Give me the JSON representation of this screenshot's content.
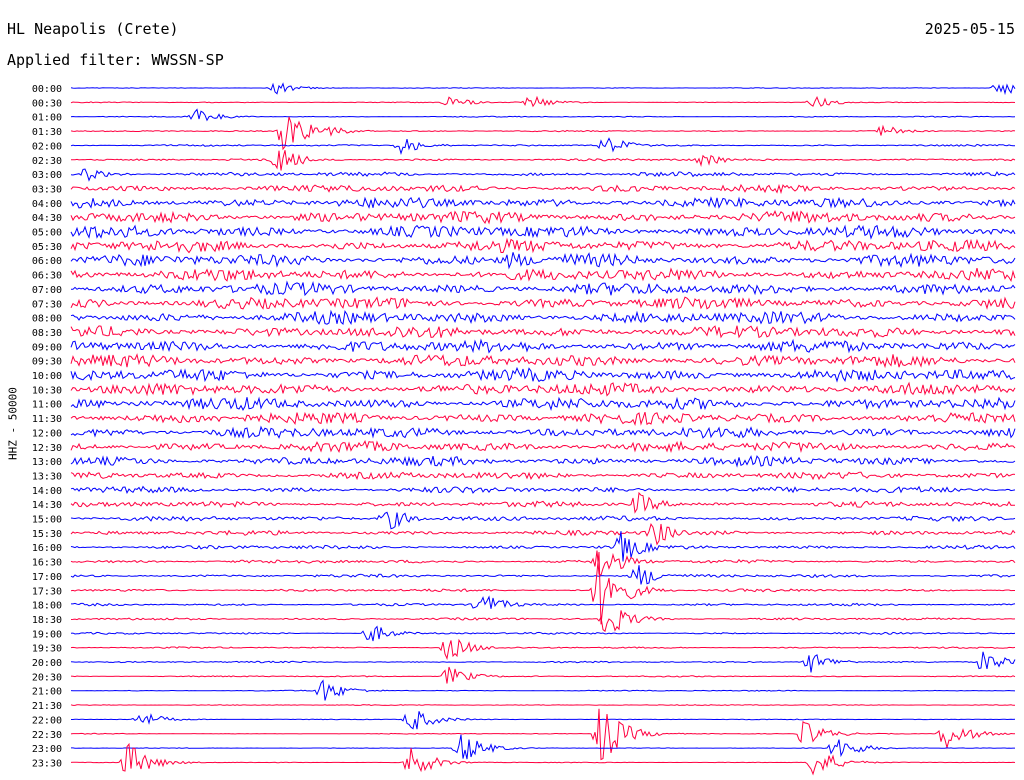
{
  "header": {
    "station": "HL Neapolis (Crete)",
    "date": "2025-05-15",
    "filter": "Applied filter: WWSSN-SP"
  },
  "chart_data": {
    "type": "line",
    "ylabel": "HHZ - 50000",
    "xlabel": "",
    "grid": false,
    "legend": "none",
    "row_labels": [
      "00:00",
      "00:30",
      "01:00",
      "01:30",
      "02:00",
      "02:30",
      "03:00",
      "03:30",
      "04:00",
      "04:30",
      "05:00",
      "05:30",
      "06:00",
      "06:30",
      "07:00",
      "07:30",
      "08:00",
      "08:30",
      "09:00",
      "09:30",
      "10:00",
      "10:30",
      "11:00",
      "11:30",
      "12:00",
      "12:30",
      "13:00",
      "13:30",
      "14:00",
      "14:30",
      "15:00",
      "15:30",
      "16:00",
      "16:30",
      "17:00",
      "17:30",
      "18:00",
      "18:30",
      "19:00",
      "19:30",
      "20:00",
      "20:30",
      "21:00",
      "21:30",
      "22:00",
      "22:30",
      "23:00",
      "23:30"
    ],
    "series_colors": [
      "#0000ff",
      "#ff0040"
    ],
    "noise_amplitude_by_row": [
      0.05,
      0.08,
      0.08,
      0.1,
      0.14,
      0.2,
      0.35,
      0.6,
      0.85,
      0.95,
      1.0,
      1.0,
      1.0,
      1.0,
      1.0,
      1.0,
      1.0,
      1.0,
      1.0,
      1.0,
      1.0,
      1.0,
      1.0,
      0.95,
      0.9,
      0.85,
      0.75,
      0.6,
      0.5,
      0.45,
      0.4,
      0.38,
      0.32,
      0.28,
      0.25,
      0.22,
      0.2,
      0.18,
      0.15,
      0.12,
      0.12,
      0.1,
      0.08,
      0.07,
      0.06,
      0.06,
      0.05,
      0.05
    ],
    "events": [
      {
        "row": 0,
        "minute": 6.5,
        "amp": 0.9
      },
      {
        "row": 0,
        "minute": 29.5,
        "amp": 1.5
      },
      {
        "row": 1,
        "minute": 12.0,
        "amp": 0.9
      },
      {
        "row": 1,
        "minute": 14.6,
        "amp": 1.0
      },
      {
        "row": 1,
        "minute": 23.6,
        "amp": 0.9
      },
      {
        "row": 2,
        "minute": 4.0,
        "amp": 1.1
      },
      {
        "row": 3,
        "minute": 6.8,
        "amp": 3.5
      },
      {
        "row": 3,
        "minute": 8.0,
        "amp": 1.0
      },
      {
        "row": 3,
        "minute": 25.8,
        "amp": 0.9
      },
      {
        "row": 4,
        "minute": 10.5,
        "amp": 1.3
      },
      {
        "row": 4,
        "minute": 17.0,
        "amp": 1.5
      },
      {
        "row": 5,
        "minute": 6.6,
        "amp": 2.0
      },
      {
        "row": 5,
        "minute": 20.0,
        "amp": 1.2
      },
      {
        "row": 6,
        "minute": 0.5,
        "amp": 1.2
      },
      {
        "row": 12,
        "minute": 14.0,
        "amp": 1.6
      },
      {
        "row": 29,
        "minute": 18.0,
        "amp": 1.8
      },
      {
        "row": 30,
        "minute": 10.0,
        "amp": 2.0
      },
      {
        "row": 31,
        "minute": 18.5,
        "amp": 2.2
      },
      {
        "row": 32,
        "minute": 17.5,
        "amp": 2.5
      },
      {
        "row": 33,
        "minute": 16.8,
        "amp": 3.0
      },
      {
        "row": 34,
        "minute": 18.0,
        "amp": 2.0
      },
      {
        "row": 35,
        "minute": 16.8,
        "amp": 6.0
      },
      {
        "row": 36,
        "minute": 13.0,
        "amp": 2.0
      },
      {
        "row": 37,
        "minute": 17.0,
        "amp": 3.0
      },
      {
        "row": 38,
        "minute": 9.5,
        "amp": 1.5
      },
      {
        "row": 39,
        "minute": 12.0,
        "amp": 2.0
      },
      {
        "row": 40,
        "minute": 23.5,
        "amp": 1.6
      },
      {
        "row": 40,
        "minute": 29.0,
        "amp": 1.8
      },
      {
        "row": 41,
        "minute": 12.0,
        "amp": 1.5
      },
      {
        "row": 42,
        "minute": 8.0,
        "amp": 1.8
      },
      {
        "row": 44,
        "minute": 2.2,
        "amp": 1.2
      },
      {
        "row": 44,
        "minute": 10.8,
        "amp": 2.0
      },
      {
        "row": 45,
        "minute": 16.8,
        "amp": 5.0
      },
      {
        "row": 45,
        "minute": 23.3,
        "amp": 2.0
      },
      {
        "row": 45,
        "minute": 27.8,
        "amp": 2.5
      },
      {
        "row": 46,
        "minute": 12.4,
        "amp": 2.5
      },
      {
        "row": 46,
        "minute": 24.3,
        "amp": 2.0
      },
      {
        "row": 47,
        "minute": 1.8,
        "amp": 3.0
      },
      {
        "row": 47,
        "minute": 10.8,
        "amp": 2.5
      },
      {
        "row": 47,
        "minute": 23.6,
        "amp": 2.5
      }
    ]
  }
}
